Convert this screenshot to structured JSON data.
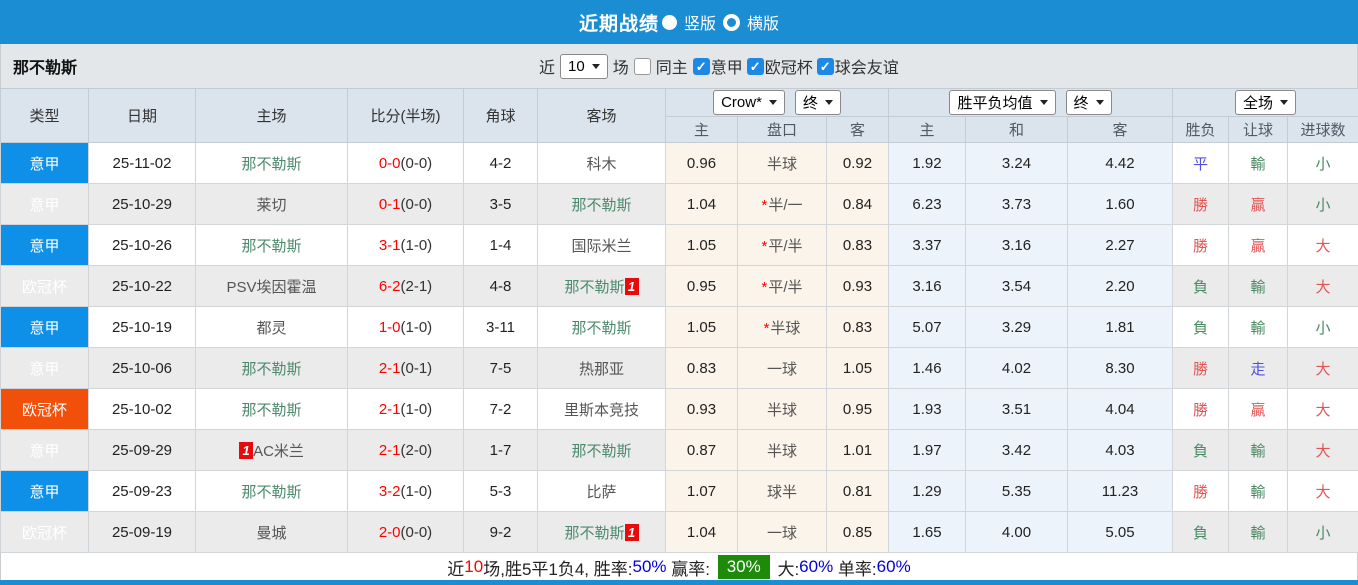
{
  "title_bar": {
    "title": "近期战绩",
    "radios": [
      {
        "label": "竖版",
        "selected": true
      },
      {
        "label": "横版",
        "selected": false
      }
    ]
  },
  "filter_bar": {
    "team": "那不勒斯",
    "recent_label": "近",
    "recent_value": "10",
    "games_label": "场",
    "same_home": {
      "label": "同主",
      "checked": false
    },
    "leagues": [
      {
        "label": "意甲",
        "checked": true
      },
      {
        "label": "欧冠杯",
        "checked": true
      },
      {
        "label": "球会友谊",
        "checked": true
      }
    ]
  },
  "table": {
    "col_headers": [
      "类型",
      "日期",
      "主场",
      "比分(半场)",
      "角球",
      "客场"
    ],
    "selects": {
      "bookmaker": "Crow*",
      "bookmaker_time": "终",
      "avg": "胜平负均值",
      "avg_time": "终",
      "scope": "全场"
    },
    "sub_headers": [
      "主",
      "盘口",
      "客",
      "主",
      "和",
      "客",
      "胜负",
      "让球",
      "进球数"
    ],
    "rows": [
      {
        "type": "意甲",
        "type_color": "lg",
        "date": "25-11-02",
        "home": "那不勒斯",
        "home_green": true,
        "home_badge": "",
        "score": "0-0",
        "half": "(0-0)",
        "corner": "4-2",
        "away": "科木",
        "away_green": false,
        "away_badge": "",
        "odds_home": "0.96",
        "star": false,
        "handicap": "半球",
        "odds_away": "0.92",
        "avg_win": "1.92",
        "avg_draw": "3.24",
        "avg_lose": "4.42",
        "sf": "平",
        "sf_c": "blue",
        "rq": "輸",
        "rq_c": "green",
        "jq": "小",
        "jq_c": "green"
      },
      {
        "type": "意甲",
        "type_color": "lg",
        "date": "25-10-29",
        "home": "莱切",
        "home_green": false,
        "home_badge": "",
        "score": "0-1",
        "half": "(0-0)",
        "corner": "3-5",
        "away": "那不勒斯",
        "away_green": true,
        "away_badge": "",
        "odds_home": "1.04",
        "star": true,
        "handicap": "半/一",
        "odds_away": "0.84",
        "avg_win": "6.23",
        "avg_draw": "3.73",
        "avg_lose": "1.60",
        "sf": "勝",
        "sf_c": "red",
        "rq": "贏",
        "rq_c": "red",
        "jq": "小",
        "jq_c": "green"
      },
      {
        "type": "意甲",
        "type_color": "lg",
        "date": "25-10-26",
        "home": "那不勒斯",
        "home_green": true,
        "home_badge": "",
        "score": "3-1",
        "half": "(1-0)",
        "corner": "1-4",
        "away": "国际米兰",
        "away_green": false,
        "away_badge": "",
        "odds_home": "1.05",
        "star": true,
        "handicap": "平/半",
        "odds_away": "0.83",
        "avg_win": "3.37",
        "avg_draw": "3.16",
        "avg_lose": "2.27",
        "sf": "勝",
        "sf_c": "red",
        "rq": "贏",
        "rq_c": "red",
        "jq": "大",
        "jq_c": "red"
      },
      {
        "type": "欧冠杯",
        "type_color": "cup",
        "date": "25-10-22",
        "home": "PSV埃因霍温",
        "home_green": false,
        "home_badge": "",
        "score": "6-2",
        "half": "(2-1)",
        "corner": "4-8",
        "away": "那不勒斯",
        "away_green": true,
        "away_badge": "1",
        "odds_home": "0.95",
        "star": true,
        "handicap": "平/半",
        "odds_away": "0.93",
        "avg_win": "3.16",
        "avg_draw": "3.54",
        "avg_lose": "2.20",
        "sf": "負",
        "sf_c": "green",
        "rq": "輸",
        "rq_c": "green",
        "jq": "大",
        "jq_c": "red"
      },
      {
        "type": "意甲",
        "type_color": "lg",
        "date": "25-10-19",
        "home": "都灵",
        "home_green": false,
        "home_badge": "",
        "score": "1-0",
        "half": "(1-0)",
        "corner": "3-11",
        "away": "那不勒斯",
        "away_green": true,
        "away_badge": "",
        "odds_home": "1.05",
        "star": true,
        "handicap": "半球",
        "odds_away": "0.83",
        "avg_win": "5.07",
        "avg_draw": "3.29",
        "avg_lose": "1.81",
        "sf": "負",
        "sf_c": "green",
        "rq": "輸",
        "rq_c": "green",
        "jq": "小",
        "jq_c": "green"
      },
      {
        "type": "意甲",
        "type_color": "lg",
        "date": "25-10-06",
        "home": "那不勒斯",
        "home_green": true,
        "home_badge": "",
        "score": "2-1",
        "half": "(0-1)",
        "corner": "7-5",
        "away": "热那亚",
        "away_green": false,
        "away_badge": "",
        "odds_home": "0.83",
        "star": false,
        "handicap": "一球",
        "odds_away": "1.05",
        "avg_win": "1.46",
        "avg_draw": "4.02",
        "avg_lose": "8.30",
        "sf": "勝",
        "sf_c": "red",
        "rq": "走",
        "rq_c": "blue",
        "jq": "大",
        "jq_c": "red"
      },
      {
        "type": "欧冠杯",
        "type_color": "cup",
        "date": "25-10-02",
        "home": "那不勒斯",
        "home_green": true,
        "home_badge": "",
        "score": "2-1",
        "half": "(1-0)",
        "corner": "7-2",
        "away": "里斯本竞技",
        "away_green": false,
        "away_badge": "",
        "odds_home": "0.93",
        "star": false,
        "handicap": "半球",
        "odds_away": "0.95",
        "avg_win": "1.93",
        "avg_draw": "3.51",
        "avg_lose": "4.04",
        "sf": "勝",
        "sf_c": "red",
        "rq": "贏",
        "rq_c": "red",
        "jq": "大",
        "jq_c": "red"
      },
      {
        "type": "意甲",
        "type_color": "lg",
        "date": "25-09-29",
        "home": "AC米兰",
        "home_green": false,
        "home_badge": "1",
        "score": "2-1",
        "half": "(2-0)",
        "corner": "1-7",
        "away": "那不勒斯",
        "away_green": true,
        "away_badge": "",
        "odds_home": "0.87",
        "star": false,
        "handicap": "半球",
        "odds_away": "1.01",
        "avg_win": "1.97",
        "avg_draw": "3.42",
        "avg_lose": "4.03",
        "sf": "負",
        "sf_c": "green",
        "rq": "輸",
        "rq_c": "green",
        "jq": "大",
        "jq_c": "red"
      },
      {
        "type": "意甲",
        "type_color": "lg",
        "date": "25-09-23",
        "home": "那不勒斯",
        "home_green": true,
        "home_badge": "",
        "score": "3-2",
        "half": "(1-0)",
        "corner": "5-3",
        "away": "比萨",
        "away_green": false,
        "away_badge": "",
        "odds_home": "1.07",
        "star": false,
        "handicap": "球半",
        "odds_away": "0.81",
        "avg_win": "1.29",
        "avg_draw": "5.35",
        "avg_lose": "11.23",
        "sf": "勝",
        "sf_c": "red",
        "rq": "輸",
        "rq_c": "green",
        "jq": "大",
        "jq_c": "red"
      },
      {
        "type": "欧冠杯",
        "type_color": "cup",
        "date": "25-09-19",
        "home": "曼城",
        "home_green": false,
        "home_badge": "",
        "score": "2-0",
        "half": "(0-0)",
        "corner": "9-2",
        "away": "那不勒斯",
        "away_green": true,
        "away_badge": "1",
        "odds_home": "1.04",
        "star": false,
        "handicap": "一球",
        "odds_away": "0.85",
        "avg_win": "1.65",
        "avg_draw": "4.00",
        "avg_lose": "5.05",
        "sf": "負",
        "sf_c": "green",
        "rq": "輸",
        "rq_c": "green",
        "jq": "小",
        "jq_c": "green"
      }
    ]
  },
  "summary": {
    "parts": [
      {
        "text": "近",
        "style": "dark"
      },
      {
        "text": "10",
        "style": "red"
      },
      {
        "text": "场,胜5平1负4, 胜率:",
        "style": "dark"
      },
      {
        "text": "50%",
        "style": "blue"
      },
      {
        "text": " 赢率: ",
        "style": "dark"
      },
      {
        "text": "30%",
        "style": "greenbox"
      },
      {
        "text": " 大:",
        "style": "dark"
      },
      {
        "text": "60%",
        "style": "blue"
      },
      {
        "text": " 单率:",
        "style": "dark"
      },
      {
        "text": "60%",
        "style": "blue"
      }
    ]
  },
  "colors": {
    "title_bar_blue": "#1b8dd3",
    "serie_a_badge_blue": "#0e90e9",
    "champions_league_orange": "#f1500a",
    "win_red": "#e25555",
    "lose_green": "#4a8a62",
    "draw_blue": "#5050dd",
    "score_red": "#ff0000",
    "team_highlight_green": "#4d8a6d",
    "rate_blue": "#0000dd",
    "win_rate_green_bg": "#1e8a0a",
    "odds_cream_bg": "#faf4ea",
    "avg_blue_bg": "#edf3fa",
    "rank_badge_red": "#e80b0b",
    "checkbox_blue": "#1e88e5"
  }
}
